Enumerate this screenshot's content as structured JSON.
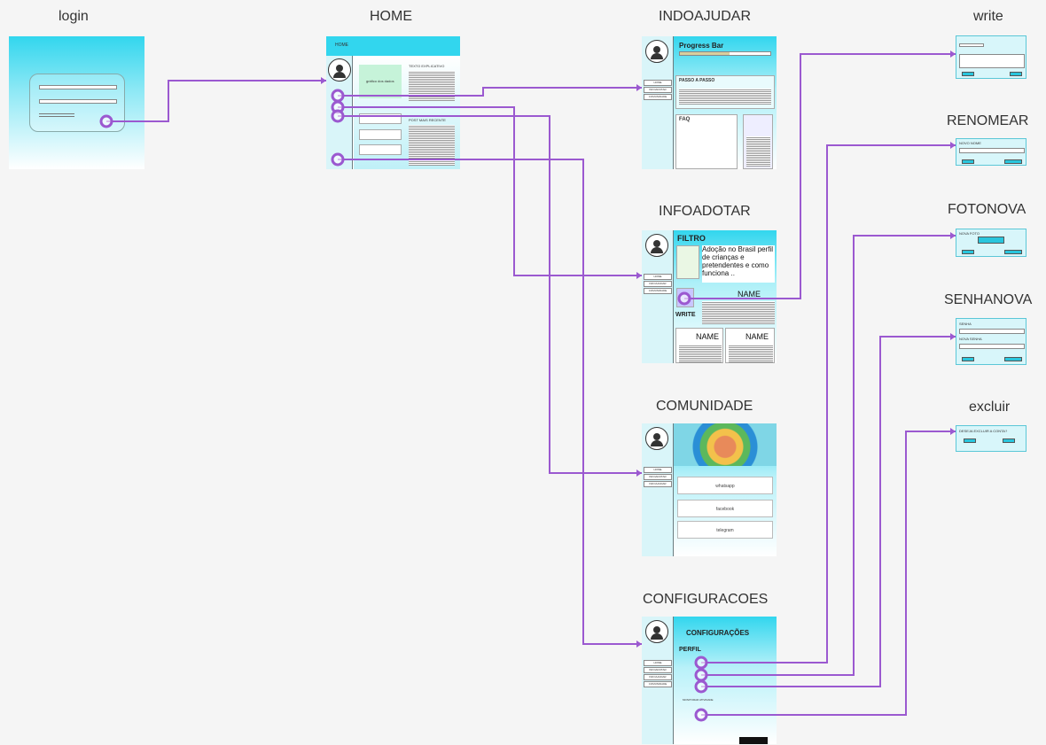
{
  "diagram": {
    "link_color": "#9b59d0",
    "frames": [
      {
        "id": "login",
        "title": "login"
      },
      {
        "id": "home",
        "title": "HOME"
      },
      {
        "id": "indoajudar",
        "title": "INDOAJUDAR"
      },
      {
        "id": "infoadotar",
        "title": "INFOADOTAR"
      },
      {
        "id": "comunidade",
        "title": "COMUNIDADE"
      },
      {
        "id": "configuracoes",
        "title": "CONFIGURACOES"
      },
      {
        "id": "write",
        "title": "write"
      },
      {
        "id": "renomear",
        "title": "RENOMEAR"
      },
      {
        "id": "fotonova",
        "title": "FOTONOVA"
      },
      {
        "id": "senhanova",
        "title": "SENHANOVA"
      },
      {
        "id": "excluir",
        "title": "excluir"
      }
    ],
    "links": [
      {
        "from": "login",
        "to": "home"
      },
      {
        "from": "home",
        "to": "indoajudar"
      },
      {
        "from": "home",
        "to": "infoadotar"
      },
      {
        "from": "home",
        "to": "comunidade"
      },
      {
        "from": "home",
        "to": "configuracoes"
      },
      {
        "from": "infoadotar",
        "to": "write"
      },
      {
        "from": "configuracoes",
        "to": "renomear"
      },
      {
        "from": "configuracoes",
        "to": "fotonova"
      },
      {
        "from": "configuracoes",
        "to": "senhanova"
      },
      {
        "from": "configuracoes",
        "to": "excluir"
      }
    ]
  },
  "home": {
    "header": "HOME",
    "box_green": "gráfico dos dados",
    "text_title": "TEXTO EXPLICATIVO",
    "post_title": "POST MAIS RECENTE"
  },
  "indoajudar": {
    "progress_title": "Progress Bar",
    "steps_title": "PASSO A PASSO",
    "faq": "FAQ",
    "side_items": [
      "HOME",
      "INFOADOTAR",
      "COMUNIDADE"
    ]
  },
  "infoadotar": {
    "filter": "FILTRO",
    "headline": "Adoção no Brasil perfil de crianças e pretendentes e como funciona ..",
    "name": "NAME",
    "write": "WRITE",
    "side_items": [
      "HOME",
      "INFOAJUDAR",
      "COMUNIDADE"
    ]
  },
  "comunidade": {
    "links": [
      "whatsapp",
      "facebook",
      "telegram"
    ],
    "side_items": [
      "HOME",
      "INFOADOTAR",
      "INFOAJUDAR"
    ]
  },
  "configuracoes": {
    "title": "CONFIGURAÇÕES",
    "profile": "PERFIL",
    "monitor": "MONITORAR ATIVIDADE",
    "side_items": [
      "HOME",
      "INFOADOTAR",
      "INFOAJUDAR",
      "COMUNIDADE"
    ]
  },
  "renomear": {
    "label": "NOVO NOME"
  },
  "fotonova": {
    "label": "NOVA FOTO"
  },
  "senhanova": {
    "label1": "SENHA",
    "label2": "NOVA SENHA"
  },
  "excluir": {
    "label": "DESEJA EXCLUIR A CONTA?"
  }
}
